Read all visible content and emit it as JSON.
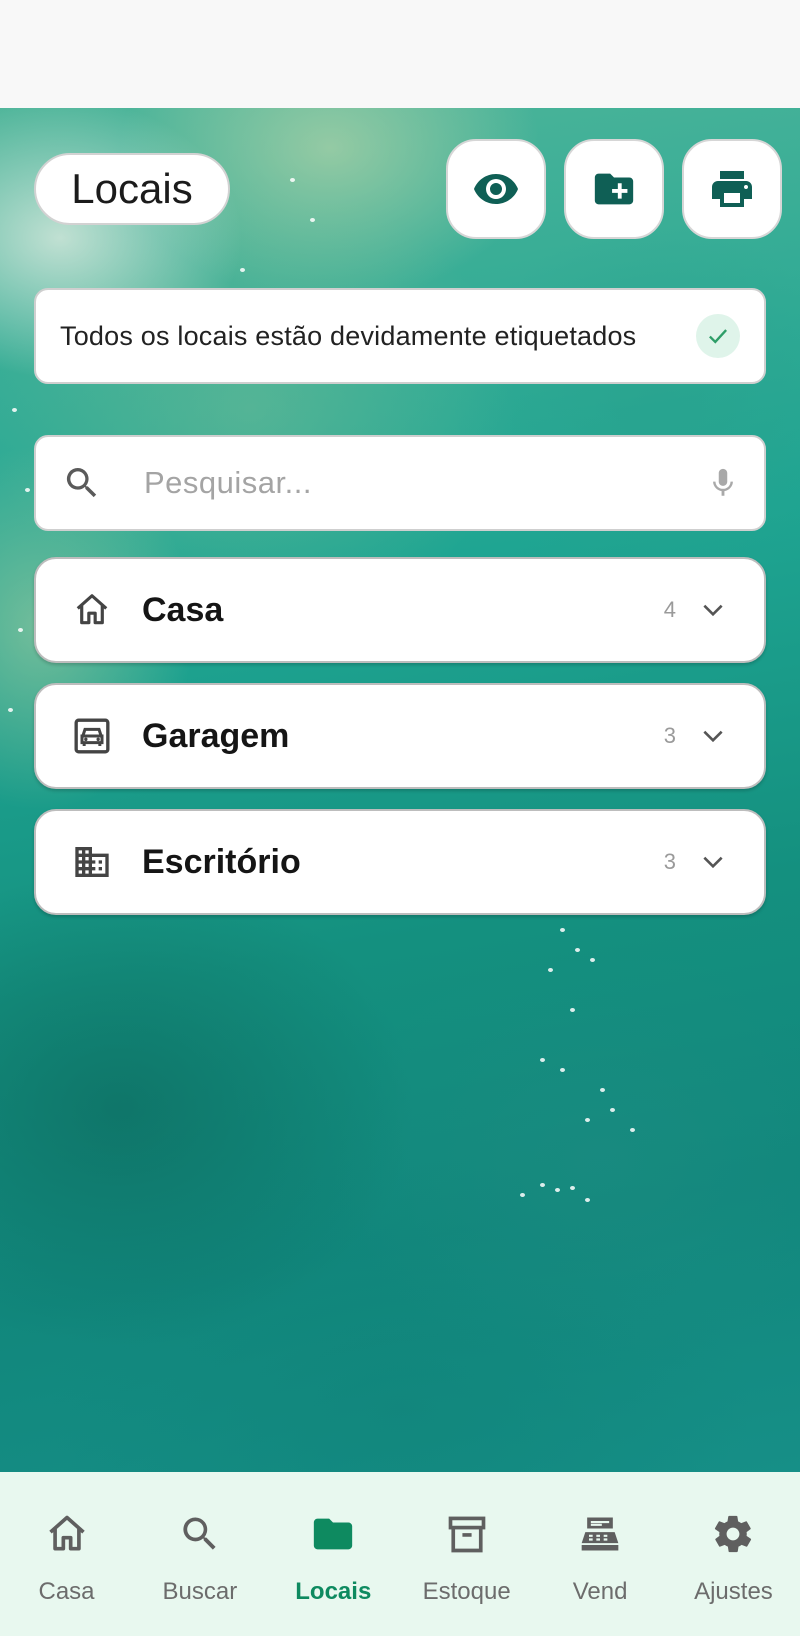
{
  "header": {
    "title": "Locais",
    "actions": [
      {
        "icon": "eye-icon"
      },
      {
        "icon": "folder-plus-icon"
      },
      {
        "icon": "printer-icon"
      }
    ]
  },
  "banner": {
    "text": "Todos os locais estão devidamente etiquetados",
    "icon": "check-icon"
  },
  "search": {
    "placeholder": "Pesquisar...",
    "left_icon": "search-icon",
    "right_icon": "microphone-icon"
  },
  "locations": [
    {
      "name": "Casa",
      "count": "4",
      "icon": "home-icon"
    },
    {
      "name": "Garagem",
      "count": "3",
      "icon": "car-icon"
    },
    {
      "name": "Escritório",
      "count": "3",
      "icon": "building-icon"
    }
  ],
  "nav": {
    "items": [
      {
        "label": "Casa",
        "icon": "home-icon"
      },
      {
        "label": "Buscar",
        "icon": "search-icon"
      },
      {
        "label": "Locais",
        "icon": "folder-icon",
        "active": true
      },
      {
        "label": "Estoque",
        "icon": "archive-box-icon"
      },
      {
        "label": "Vend",
        "icon": "cash-register-icon"
      },
      {
        "label": "Ajustes",
        "icon": "gear-icon"
      }
    ]
  },
  "colors": {
    "accent": "#0e8a60",
    "header_icon": "#0f5f55",
    "nav_background": "#e8f8ef"
  }
}
